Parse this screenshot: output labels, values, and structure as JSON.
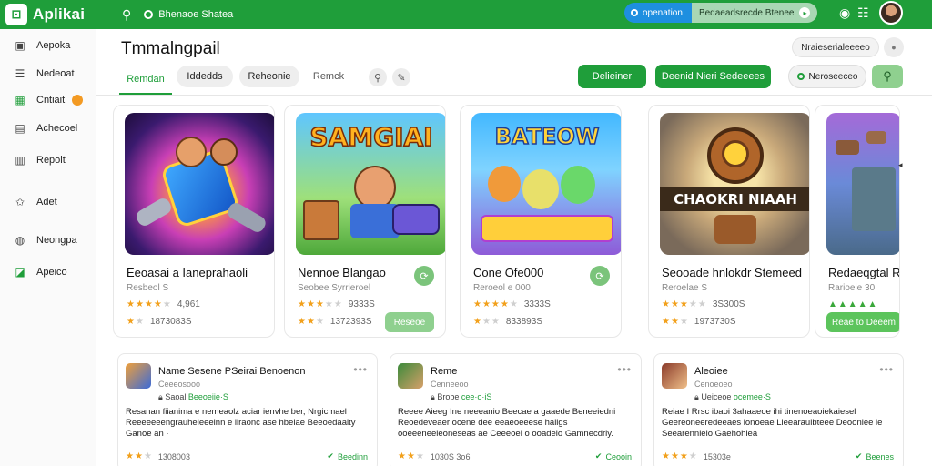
{
  "topbar": {
    "app_name": "Aplikai",
    "status_text": "Bhenaoe Shatea",
    "pill_blue_label": "openation",
    "pill_grey_label": "Bedaeadsrecde Btenee",
    "accent_color": "#1f9e3a"
  },
  "sidebar": {
    "items": [
      {
        "label": "Aepoka",
        "icon": "grid-icon"
      },
      {
        "label": "Nedeoat",
        "icon": "list-icon"
      },
      {
        "label": "Cntiait",
        "icon": "chart-icon"
      },
      {
        "label": "Achecoel",
        "icon": "box-icon"
      },
      {
        "label": "Repoit",
        "icon": "document-icon"
      },
      {
        "label": "Adet",
        "icon": "star-icon"
      },
      {
        "label": "Neongpa",
        "icon": "globe-icon"
      },
      {
        "label": "Apeico",
        "icon": "apps-icon"
      }
    ]
  },
  "main": {
    "title": "Tmmalngpail",
    "tabs": [
      "Remdan",
      "Iddedds",
      "Reheonie",
      "Remck"
    ],
    "btn_primary_1": "Delieiner",
    "btn_primary_2": "Deenid Nieri Sedeeees",
    "btn_outline": "Neroseeceo",
    "filter_label": "Nraieserialeeeeo"
  },
  "featured": [
    {
      "art_text": "",
      "title": "Eeoasai a Ianeprahaoli",
      "sub": "Resbeol S",
      "rating": "4,961",
      "count": "1873083S",
      "stars": 4
    },
    {
      "art_text": "SAMGIAI",
      "title": "Nennoe Blangao",
      "sub": "Seobee Syrrieroel",
      "rating": "9333S",
      "count": "1372393S",
      "stars": 3,
      "action": "Reseoe"
    },
    {
      "art_text": "BATEOW",
      "title": "Cone Ofe000",
      "sub": "Reroeol e 000",
      "rating": "3333S",
      "count": "833893S",
      "stars": 4
    },
    {
      "art_text": "CHAOKRI NIAAH",
      "title": "Seooade hnlokdr Stemeed",
      "sub": "Reroelae S",
      "rating": "3S300S",
      "count": "1973730S",
      "stars": 3
    },
    {
      "art_text": "",
      "title": "Redaeqgtal R",
      "sub": "Rarioeie 30",
      "rating": "",
      "count": "",
      "stars": 3,
      "action": "Reae to Deeem"
    }
  ],
  "reviews": [
    {
      "name": "Name Sesene PSeirai Benoenon",
      "sub": "Ceeeosooo",
      "link_prefix": "Saoal",
      "link": "Beeoeiie·S",
      "body": "Resanan fiianima e nemeaolz aciar ienvhe ber, Nrgicmael Reeeeeeengrauheieeeinn e liraonc ase hbeiae Beeoedaaity Ganoe an ·",
      "highlight": "Beeoedaaity",
      "rating": "1308003",
      "status": "Beedinn"
    },
    {
      "name": "Reme",
      "sub": "Cenneeoo",
      "link_prefix": "Brobe",
      "link": "cee·o·iS",
      "body": "Reeee Aieeg Ine neeeanio Beecae a gaaede Beneeiedni Reoedeveaer ocene dee eeaeoeeese haiigs ooeeeneeieoneseas ae Ceeeoel o ooadeio Gamnecdriy.",
      "highlight": "Gamnecdriy.",
      "rating": "1030S 3o6",
      "status": "Ceooin"
    },
    {
      "name": "Aleoiee",
      "sub": "Cenoeoeo",
      "link_prefix": "Ueiceoe",
      "link": "ocemee·S",
      "body": "Reiae I Rrsc ibaoi 3ahaaeoe ihi tinenoeaoiekaiesel Geereoneeredeeaes lonoeae Lieearauibteee Deooniee ie Seearennieio Gaehohiea",
      "highlight": "Gaehohiea",
      "rating": "15303e",
      "status": "Beenes"
    }
  ]
}
